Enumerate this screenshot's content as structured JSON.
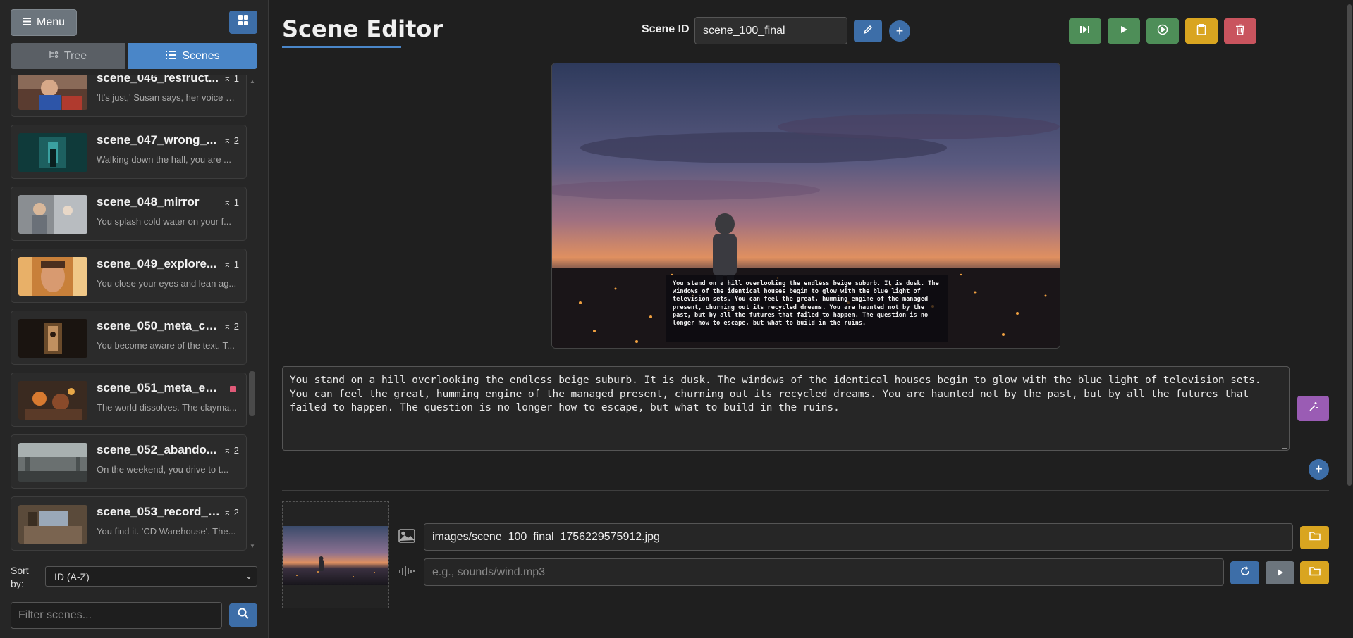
{
  "sidebar": {
    "menu_label": "Menu",
    "tabs": [
      {
        "label": "Tree"
      },
      {
        "label": "Scenes"
      }
    ],
    "scenes": [
      {
        "name": "scene_046_restruct...",
        "desc": "'It's just,' Susan says, her voice q...",
        "count": "1"
      },
      {
        "name": "scene_047_wrong_...",
        "desc": "Walking down the hall, you are ...",
        "count": "2"
      },
      {
        "name": "scene_048_mirror",
        "desc": "You splash cold water on your f...",
        "count": "1"
      },
      {
        "name": "scene_049_explore...",
        "desc": "You close your eyes and lean ag...",
        "count": "1"
      },
      {
        "name": "scene_050_meta_ch...",
        "desc": "You become aware of the text. T...",
        "count": "2"
      },
      {
        "name": "scene_051_meta_en...",
        "desc": "The world dissolves. The clayma...",
        "count": ""
      },
      {
        "name": "scene_052_abando...",
        "desc": "On the weekend, you drive to t...",
        "count": "2"
      },
      {
        "name": "scene_053_record_s...",
        "desc": "You find it. 'CD Warehouse'. The...",
        "count": "2"
      }
    ],
    "sort_label": "Sort by:",
    "sort_value": "ID (A-Z)",
    "filter_placeholder": "Filter scenes..."
  },
  "editor": {
    "title": "Scene Editor",
    "scene_id_label": "Scene ID",
    "scene_id_value": "scene_100_final",
    "scene_text": "You stand on a hill overlooking the endless beige suburb. It is dusk. The windows of the identical houses begin to glow with the blue light of television sets. You can feel the great, humming engine of the managed present, churning out its recycled dreams. You are haunted not by the past, but by all the futures that failed to happen. The question is no longer how to escape, but what to build in the ruins.",
    "image_path": "images/scene_100_final_1756229575912.jpg",
    "audio_placeholder": "e.g., sounds/wind.mp3"
  },
  "colors": {
    "accent": "#4a86c8",
    "green": "#4e8e58",
    "yellow": "#d9a520",
    "red": "#c9545e",
    "purple": "#9a5cb4"
  }
}
